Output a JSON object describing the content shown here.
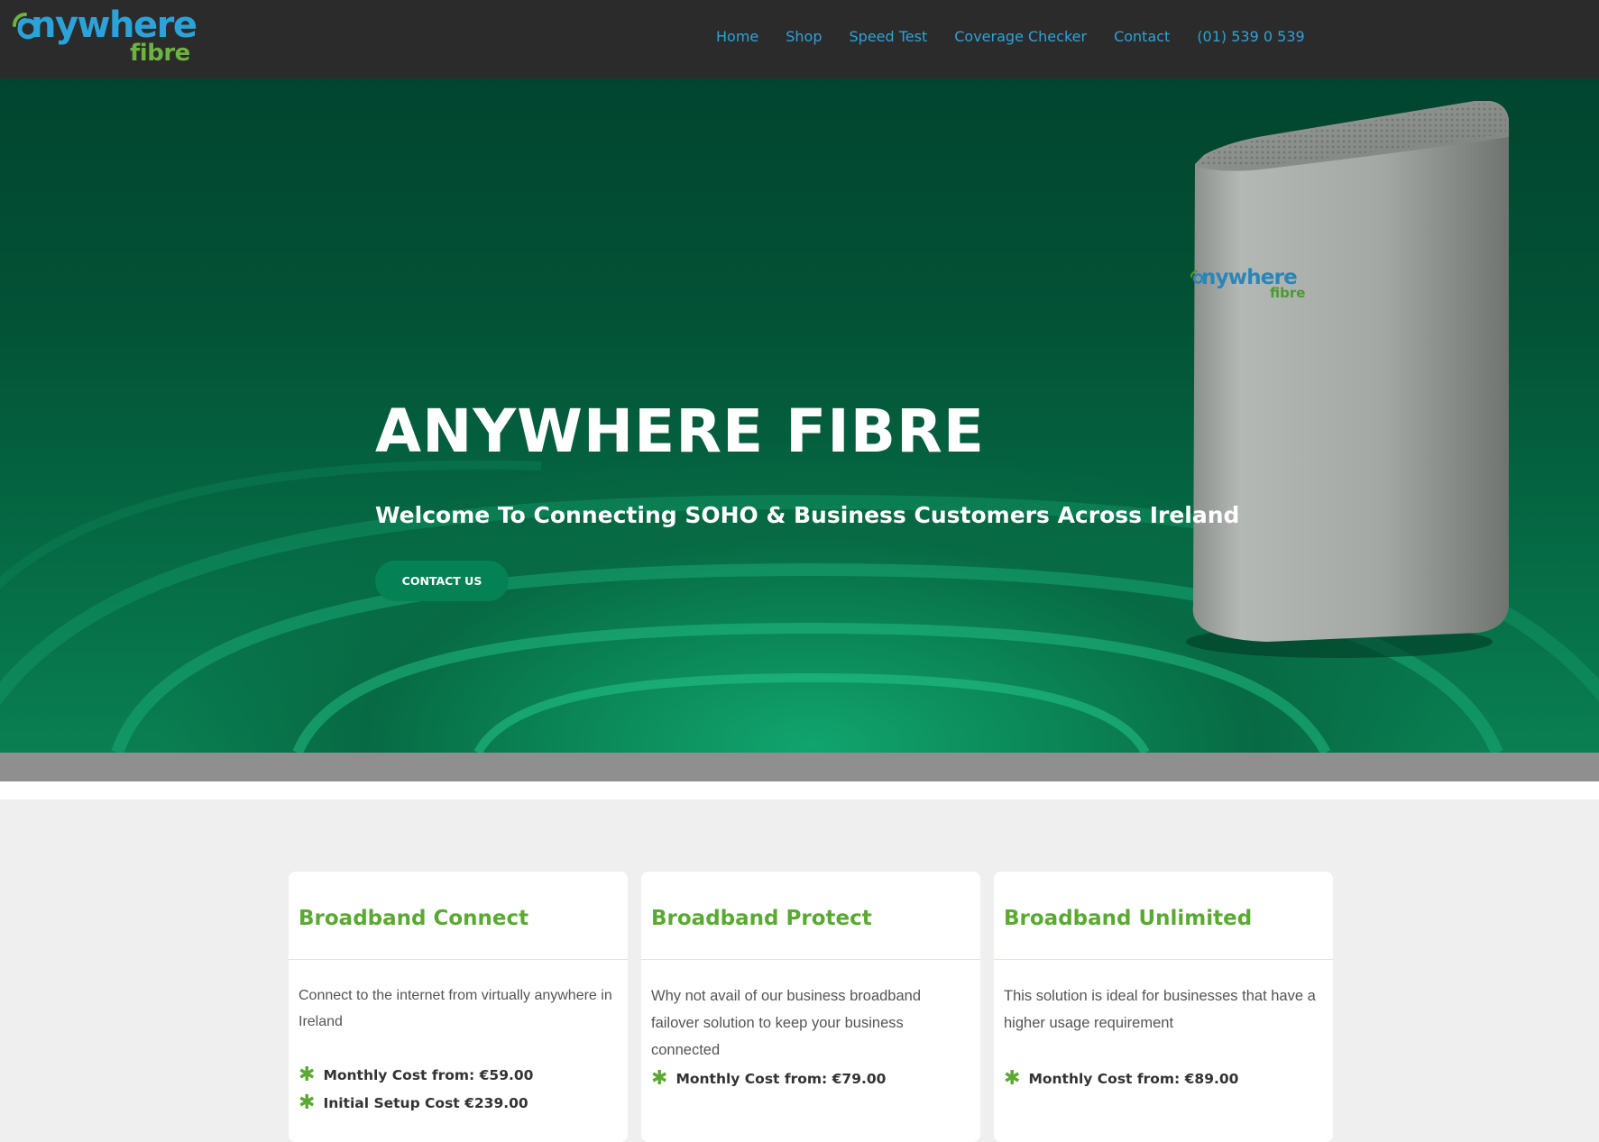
{
  "brand": {
    "word": "nywhere",
    "sub": "fibre"
  },
  "nav": {
    "items": [
      "Home",
      "Shop",
      "Speed Test",
      "Coverage Checker",
      "Contact",
      "(01) 539 0 539"
    ]
  },
  "hero": {
    "title": "ANYWHERE FIBRE",
    "subtitle": "Welcome To Connecting SOHO & Business Customers Across Ireland",
    "cta": "CONTACT US",
    "router_brand": {
      "word": "nywhere",
      "sub": "fibre"
    }
  },
  "cards": [
    {
      "title": "Broadband Connect",
      "description": "Connect to the internet from virtually anywhere in Ireland",
      "features": [
        "Monthly Cost from: €59.00",
        "Initial Setup Cost €239.00"
      ]
    },
    {
      "title": "Broadband Protect",
      "description": "Why not avail of our business broadband failover solution to keep your business connected",
      "features": [
        "Monthly Cost from: €79.00"
      ]
    },
    {
      "title": "Broadband Unlimited",
      "description": "This solution is ideal for businesses that have a higher usage requirement",
      "features": [
        "Monthly Cost from: €89.00"
      ]
    }
  ],
  "colors": {
    "header_bg": "#2b2b2b",
    "nav_link": "#2ca3d8",
    "brand_blue": "#2ca3d8",
    "brand_green": "#6cb33f",
    "hero_button": "#058156",
    "card_title": "#5aaa32"
  }
}
